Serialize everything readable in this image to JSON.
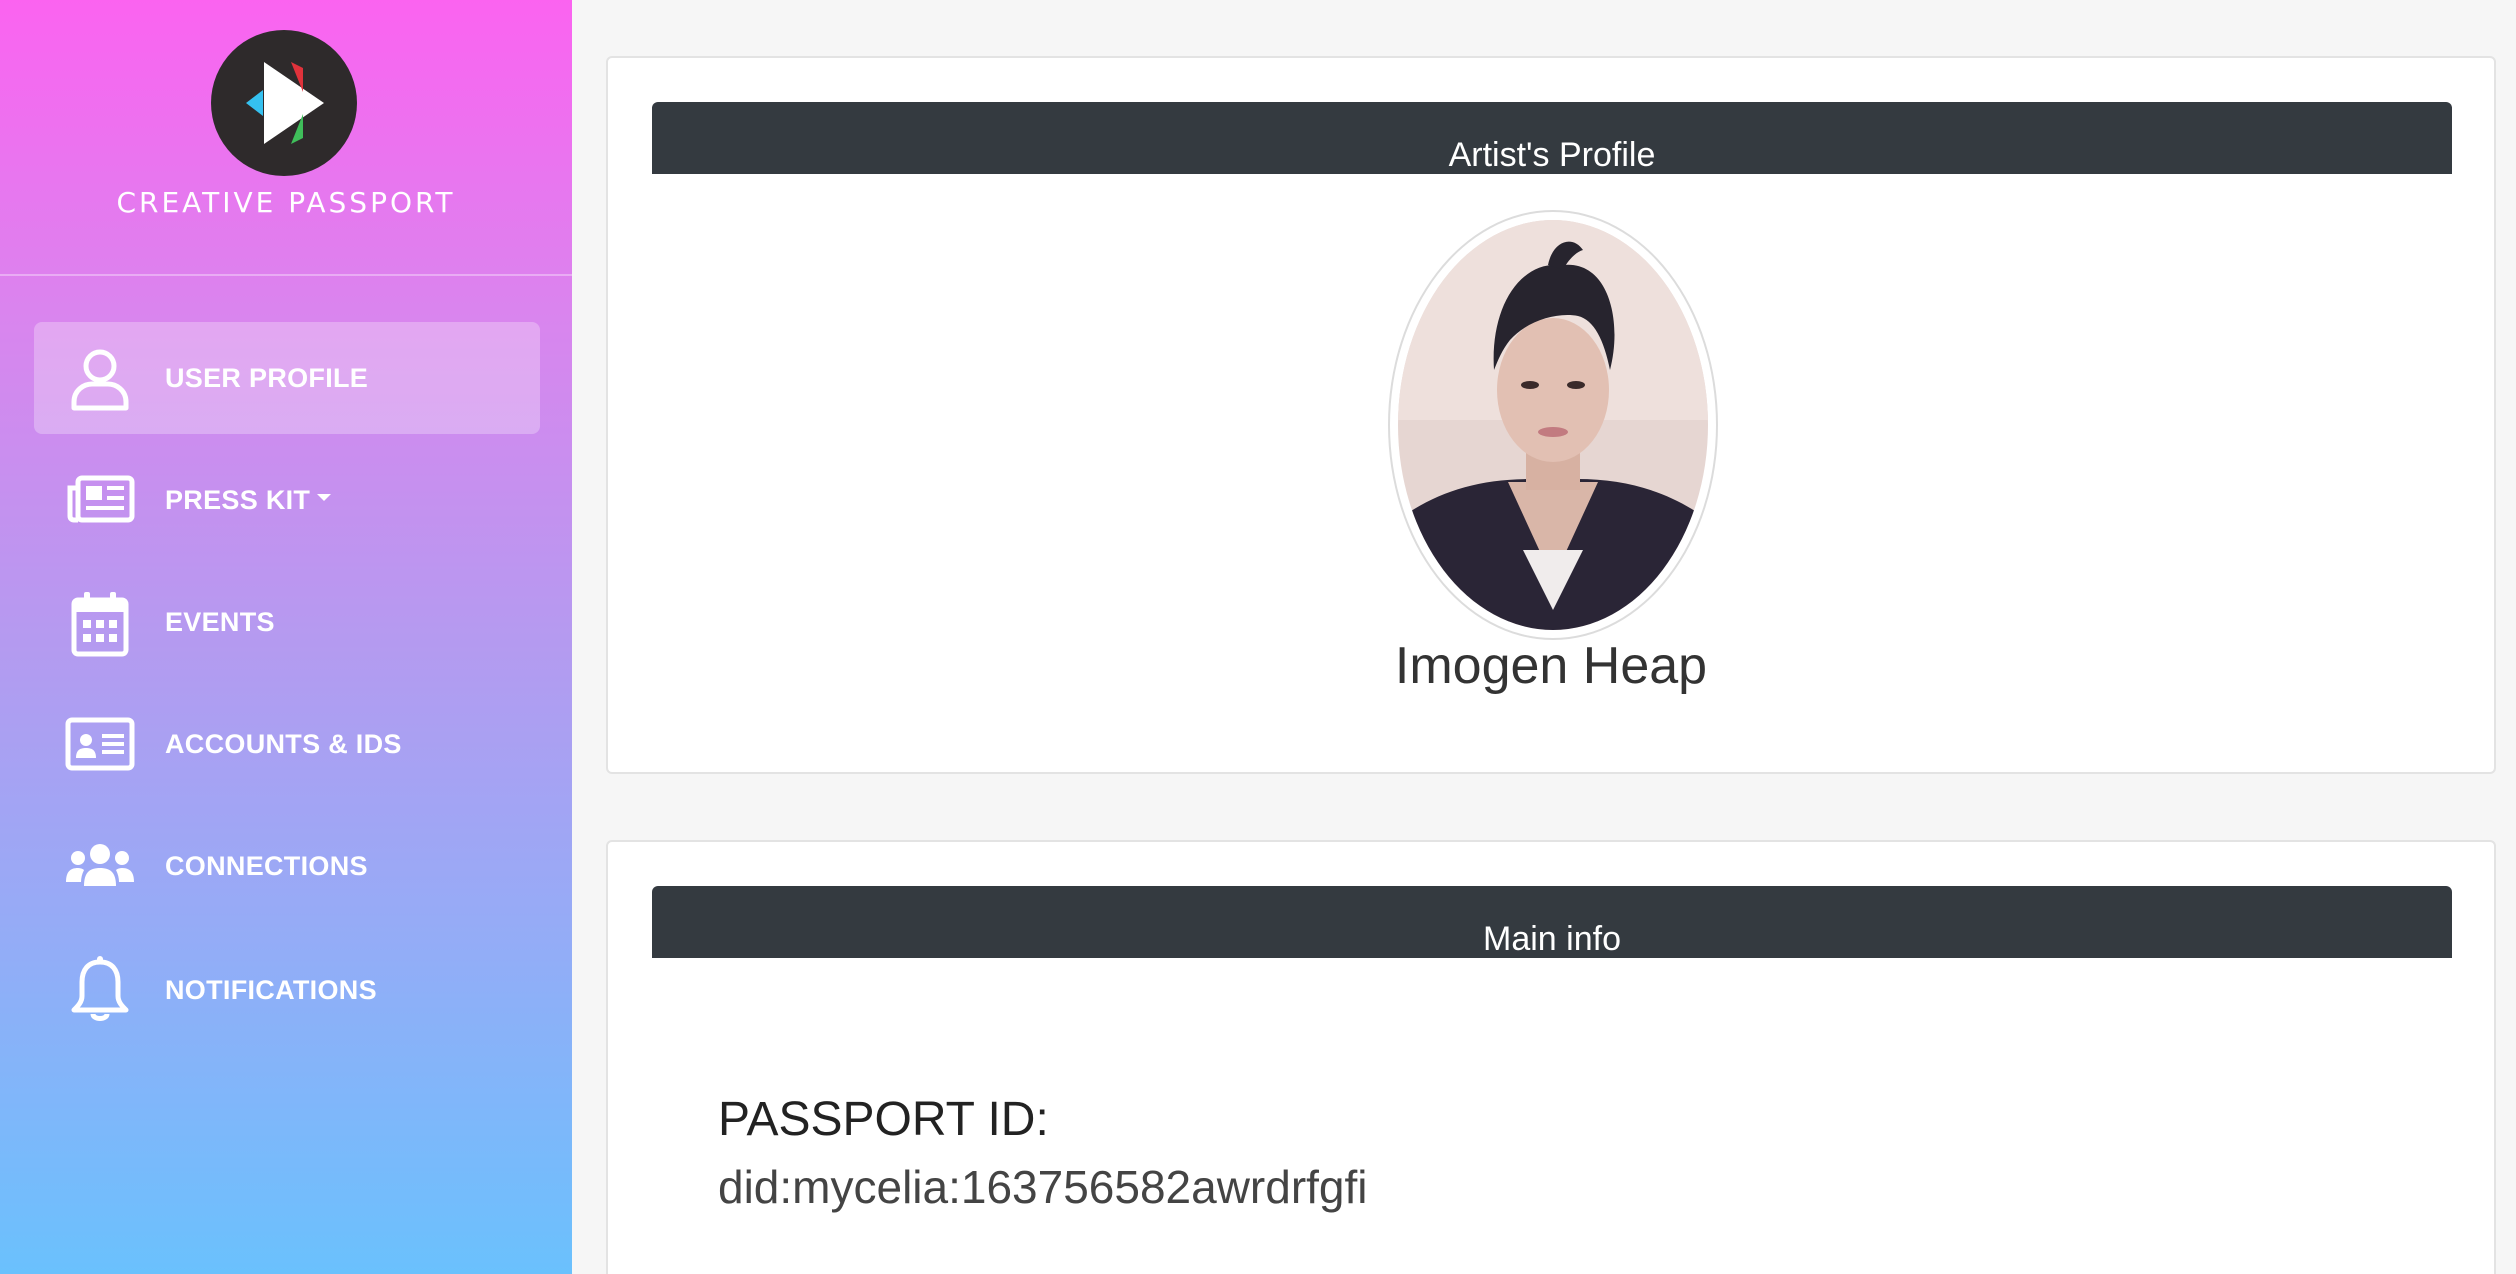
{
  "sidebar": {
    "brand": "CREATIVE PASSPORT",
    "items": [
      {
        "label": "USER PROFILE",
        "icon": "user-icon",
        "active": true
      },
      {
        "label": "PRESS KIT",
        "icon": "newspaper-icon",
        "dropdown": true
      },
      {
        "label": "EVENTS",
        "icon": "calendar-icon"
      },
      {
        "label": "ACCOUNTS & IDS",
        "icon": "id-card-icon"
      },
      {
        "label": "CONNECTIONS",
        "icon": "users-icon"
      },
      {
        "label": "NOTIFICATIONS",
        "icon": "bell-icon"
      }
    ]
  },
  "profile_card": {
    "header": "Artist's Profile",
    "artist_name": "Imogen Heap"
  },
  "main_info_card": {
    "header": "Main info",
    "passport_label": "PASSPORT ID:",
    "passport_value": "did:mycelia:163756582awrdrfgfi"
  },
  "colors": {
    "sidebar_gradient_top": "#fb63f0",
    "sidebar_gradient_bottom": "#6ac1fd",
    "card_header": "#343a40",
    "logo_bg": "#2e2a2b"
  }
}
